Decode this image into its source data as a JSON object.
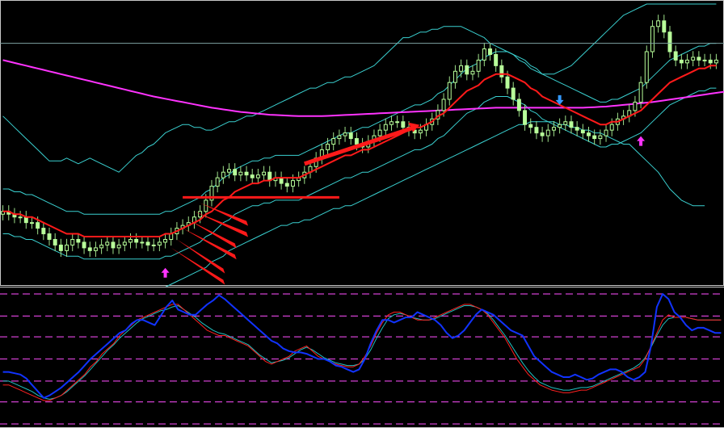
{
  "colors": {
    "background": "#000000",
    "frame": "#c8c8c8",
    "level_line": "#7fa5a5",
    "bull_candle": "#b8ff9a",
    "bear_candle": "#b8ff9a",
    "wick": "#9fe08a",
    "midline_ma": "#ff1a1a",
    "long_ma": "#ff33ff",
    "bands": "#3ad0d0",
    "envelope": "#8fd8d8",
    "arrow_up": "#ff33ff",
    "arrow_down": "#3399ff",
    "annotation": "#ff1a1a",
    "osc_main": "#1133ff",
    "osc_signal_a": "#ff2020",
    "osc_signal_b": "#20c0c0",
    "osc_levels": "#d040d0"
  },
  "chart_data": [
    {
      "type": "candlestick",
      "title": "",
      "xlabel": "",
      "ylabel": "",
      "ylim": [
        0,
        100
      ],
      "grid": false,
      "levels": [
        86
      ],
      "closes": [
        26,
        25,
        24,
        24,
        22,
        22,
        20,
        18,
        16,
        14,
        12,
        14,
        16,
        15,
        13,
        12,
        13,
        14,
        15,
        13,
        14,
        15,
        16,
        15,
        15,
        14,
        14,
        15,
        16,
        18,
        20,
        21,
        22,
        24,
        26,
        30,
        35,
        38,
        40,
        41,
        39,
        40,
        39,
        38,
        39,
        40,
        37,
        38,
        36,
        35,
        37,
        38,
        40,
        42,
        45,
        48,
        50,
        52,
        53,
        54,
        52,
        50,
        49,
        51,
        53,
        55,
        57,
        58,
        58,
        56,
        55,
        54,
        55,
        57,
        59,
        62,
        66,
        72,
        76,
        78,
        75,
        76,
        80,
        84,
        82,
        78,
        74,
        70,
        66,
        62,
        57,
        56,
        54,
        53,
        55,
        56,
        57,
        58,
        56,
        55,
        54,
        53,
        52,
        53,
        55,
        57,
        59,
        60,
        62,
        65,
        72,
        83,
        92,
        94,
        90,
        83,
        80,
        79,
        80,
        81,
        80,
        80,
        79,
        80
      ],
      "band_upper": [
        60,
        58,
        56,
        54,
        52,
        50,
        48,
        46,
        44,
        44,
        44,
        45,
        44,
        43,
        44,
        45,
        44,
        43,
        42,
        41,
        40,
        42,
        44,
        46,
        47,
        49,
        50,
        52,
        54,
        55,
        56,
        57,
        57,
        56,
        56,
        55,
        55,
        56,
        57,
        58,
        58,
        59,
        60,
        60,
        61,
        62,
        63,
        64,
        65,
        66,
        67,
        68,
        69,
        70,
        70,
        71,
        72,
        72,
        73,
        74,
        74,
        75,
        76,
        77,
        78,
        80,
        82,
        84,
        86,
        88,
        88,
        89,
        90,
        90,
        91,
        91,
        92,
        92,
        92,
        92,
        91,
        90,
        89,
        88,
        86,
        85,
        84,
        83,
        82,
        80,
        79,
        77,
        76,
        75,
        75,
        75,
        76,
        77,
        78,
        80,
        82,
        84,
        86,
        88,
        90,
        92,
        94,
        96,
        97,
        98,
        99,
        100,
        100,
        100,
        100,
        100,
        100,
        100,
        100,
        100,
        100,
        100,
        100,
        100
      ],
      "band_mid": [
        26,
        26,
        25,
        25,
        24,
        24,
        23,
        22,
        21,
        20,
        19,
        18,
        18,
        18,
        17,
        17,
        17,
        17,
        17,
        17,
        17,
        17,
        17,
        17,
        17,
        17,
        17,
        17,
        18,
        18,
        19,
        20,
        21,
        22,
        23,
        25,
        26,
        28,
        30,
        31,
        33,
        34,
        35,
        36,
        36,
        37,
        37,
        38,
        38,
        38,
        38,
        38,
        39,
        40,
        41,
        42,
        43,
        44,
        45,
        46,
        46,
        47,
        48,
        48,
        49,
        50,
        51,
        52,
        53,
        54,
        55,
        56,
        56,
        57,
        58,
        60,
        61,
        63,
        65,
        67,
        69,
        70,
        71,
        73,
        74,
        75,
        75,
        75,
        74,
        73,
        72,
        70,
        69,
        67,
        66,
        65,
        64,
        63,
        62,
        61,
        60,
        59,
        58,
        57,
        57,
        58,
        58,
        59,
        60,
        61,
        62,
        64,
        66,
        68,
        70,
        72,
        73,
        74,
        75,
        76,
        77,
        77,
        78,
        78
      ],
      "band_lower": [
        -6,
        -6,
        -6,
        -7,
        -7,
        -8,
        -8,
        -8,
        -9,
        -9,
        -9,
        -9,
        -9,
        -9,
        -8,
        -8,
        -7,
        -7,
        -6,
        -5,
        -5,
        -4,
        -3,
        -3,
        -3,
        -2,
        -2,
        -2,
        -1,
        0,
        1,
        2,
        3,
        4,
        5,
        6,
        8,
        9,
        10,
        12,
        13,
        14,
        15,
        16,
        17,
        18,
        19,
        20,
        21,
        21,
        22,
        22,
        23,
        23,
        24,
        25,
        26,
        27,
        27,
        28,
        28,
        29,
        30,
        31,
        32,
        33,
        34,
        35,
        36,
        37,
        38,
        39,
        40,
        41,
        42,
        43,
        44,
        45,
        46,
        47,
        48,
        49,
        50,
        51,
        52,
        53,
        54,
        55,
        56,
        57,
        57,
        58,
        58,
        58,
        58,
        58,
        57,
        57,
        56,
        56,
        55,
        55,
        54,
        54,
        53,
        52,
        51,
        50,
        50,
        48,
        46,
        44,
        42,
        40,
        37,
        34,
        32,
        30,
        29,
        28,
        28,
        28
      ],
      "long_ma": [
        80,
        79.5,
        79,
        78.5,
        78,
        77.5,
        77,
        76.5,
        76,
        75.5,
        75,
        74.5,
        74,
        73.5,
        73,
        72.5,
        72,
        71.5,
        71,
        70.5,
        70,
        69.5,
        69,
        68.5,
        68,
        67.5,
        67,
        66.6,
        66.2,
        65.8,
        65.4,
        65,
        64.6,
        64.2,
        63.8,
        63.4,
        63,
        62.7,
        62.4,
        62.1,
        61.8,
        61.5,
        61.3,
        61.1,
        60.9,
        60.7,
        60.5,
        60.4,
        60.3,
        60.2,
        60.1,
        60,
        60,
        60,
        60,
        60,
        60.1,
        60.2,
        60.3,
        60.4,
        60.5,
        60.6,
        60.7,
        60.8,
        60.9,
        61,
        61.1,
        61.2,
        61.3,
        61.4,
        61.5,
        61.6,
        61.7,
        61.8,
        61.9,
        62,
        62.1,
        62.2,
        62.3,
        62.4,
        62.5,
        62.6,
        62.7,
        62.8,
        62.9,
        63,
        63,
        63,
        63,
        63,
        63,
        63,
        63,
        63,
        63,
        63,
        63,
        63,
        63,
        63,
        63,
        63.1,
        63.2,
        63.3,
        63.4,
        63.6,
        63.8,
        64,
        64.2,
        64.4,
        64.6,
        64.8,
        65,
        65.3,
        65.6,
        65.9,
        66.2,
        66.5,
        66.8,
        67.1,
        67.4,
        67.7,
        68,
        68.3,
        68.6,
        68.9
      ],
      "arrows_up": [
        28,
        110
      ],
      "arrows_down": [
        96
      ]
    },
    {
      "type": "line",
      "title": "",
      "xlabel": "",
      "ylabel": "",
      "ylim": [
        0,
        100
      ],
      "grid": false,
      "levels": [
        100,
        83,
        67,
        50,
        33,
        17,
        0
      ],
      "main": [
        40,
        40,
        39,
        38,
        35,
        30,
        25,
        20,
        22,
        25,
        28,
        32,
        36,
        40,
        45,
        50,
        54,
        58,
        62,
        66,
        70,
        72,
        77,
        80,
        80,
        78,
        76,
        83,
        90,
        95,
        88,
        86,
        84,
        84,
        88,
        92,
        95,
        99,
        96,
        92,
        88,
        84,
        80,
        76,
        72,
        68,
        64,
        62,
        58,
        56,
        55,
        55,
        54,
        52,
        50,
        50,
        48,
        45,
        44,
        42,
        40,
        42,
        50,
        62,
        72,
        80,
        80,
        78,
        80,
        82,
        82,
        86,
        84,
        82,
        80,
        76,
        70,
        66,
        68,
        72,
        78,
        84,
        88,
        86,
        84,
        80,
        76,
        72,
        70,
        68,
        60,
        52,
        48,
        44,
        40,
        38,
        36,
        36,
        38,
        36,
        34,
        35,
        38,
        40,
        42,
        42,
        40,
        36,
        34,
        36,
        40,
        60,
        90,
        100,
        96,
        86,
        82,
        76,
        72,
        74,
        74,
        72,
        70,
        70
      ],
      "signal_a": [
        30,
        30,
        28,
        26,
        24,
        22,
        20,
        18,
        18,
        20,
        22,
        26,
        30,
        34,
        38,
        44,
        48,
        54,
        58,
        62,
        68,
        72,
        76,
        80,
        82,
        84,
        86,
        88,
        90,
        92,
        92,
        88,
        84,
        80,
        76,
        72,
        70,
        68,
        68,
        66,
        64,
        62,
        60,
        56,
        52,
        48,
        46,
        48,
        50,
        52,
        56,
        58,
        60,
        56,
        52,
        50,
        48,
        46,
        45,
        44,
        44,
        46,
        52,
        60,
        70,
        78,
        84,
        86,
        86,
        84,
        82,
        80,
        80,
        80,
        82,
        84,
        86,
        88,
        90,
        92,
        92,
        90,
        88,
        84,
        78,
        72,
        66,
        58,
        50,
        44,
        38,
        34,
        30,
        28,
        26,
        25,
        24,
        24,
        25,
        26,
        26,
        28,
        30,
        32,
        34,
        36,
        38,
        40,
        42,
        44,
        50,
        60,
        70,
        80,
        84,
        82,
        82,
        82,
        81,
        80,
        80,
        80,
        80,
        80
      ],
      "signal_b": [
        33,
        33,
        31,
        29,
        27,
        25,
        22,
        20,
        19,
        20,
        22,
        25,
        29,
        33,
        37,
        42,
        47,
        52,
        57,
        61,
        66,
        70,
        74,
        78,
        81,
        83,
        85,
        87,
        88,
        90,
        91,
        88,
        85,
        82,
        78,
        75,
        72,
        70,
        69,
        67,
        65,
        63,
        61,
        57,
        53,
        50,
        47,
        48,
        49,
        51,
        54,
        57,
        59,
        57,
        54,
        51,
        49,
        47,
        46,
        45,
        45,
        46,
        50,
        57,
        66,
        74,
        81,
        84,
        85,
        84,
        82,
        81,
        80,
        80,
        81,
        83,
        85,
        87,
        89,
        91,
        91,
        90,
        88,
        85,
        80,
        74,
        68,
        61,
        54,
        47,
        41,
        36,
        32,
        30,
        28,
        27,
        26,
        26,
        27,
        28,
        28,
        29,
        31,
        33,
        35,
        37,
        39,
        41,
        43,
        46,
        51,
        59,
        68,
        76,
        81,
        82,
        82,
        82,
        81,
        80,
        80,
        80,
        80,
        80
      ]
    }
  ]
}
